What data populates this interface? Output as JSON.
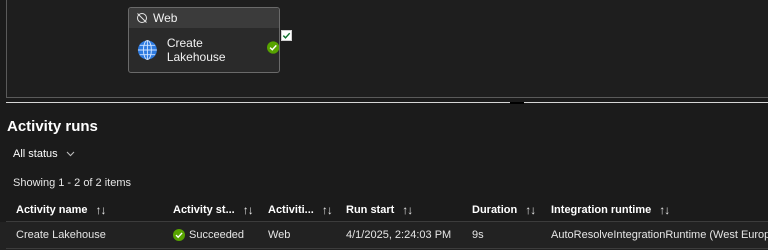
{
  "canvas": {
    "node": {
      "type_label": "Web",
      "activity_label": "Create Lakehouse",
      "status_icon": "success-check-icon",
      "activity_icon": "globe-icon"
    }
  },
  "activity_runs": {
    "title": "Activity runs",
    "status_filter": "All status",
    "showing_text": "Showing 1 - 2 of 2 items",
    "columns": [
      {
        "label": "Activity name"
      },
      {
        "label": "Activity st..."
      },
      {
        "label": "Activiti..."
      },
      {
        "label": "Run start"
      },
      {
        "label": "Duration"
      },
      {
        "label": "Integration runtime"
      }
    ],
    "sort_glyph": "↑↓",
    "rows": [
      {
        "activity_name": "Create Lakehouse",
        "activity_status": "Succeeded",
        "activity_type": "Web",
        "run_start": "4/1/2025, 2:24:03 PM",
        "duration": "9s",
        "integration_runtime": "AutoResolveIntegrationRuntime (West Europe)"
      }
    ]
  },
  "colors": {
    "background": "#1b1b1b",
    "success": "#57a300",
    "globe": "#2d7ae0"
  }
}
